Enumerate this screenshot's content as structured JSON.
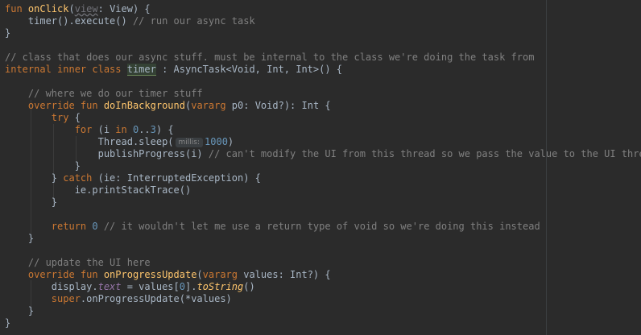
{
  "editor": {
    "lines": {
      "l1": {
        "kw": "fun ",
        "name": "onClick",
        "open": "(",
        "param": "view",
        "rest": ": View) {"
      },
      "l2": {
        "code": "    timer().execute() ",
        "comment": "// run our async task"
      },
      "l3": {
        "code": "}"
      },
      "l5": {
        "comment": "// class that does our async stuff. must be internal to the class we're doing the task from"
      },
      "l6": {
        "kw": "internal inner class ",
        "name": "timer",
        "rest": " : AsyncTask<Void, Int, Int>() {"
      },
      "l8": {
        "comment": "    // where we do our timer stuff"
      },
      "l9": {
        "kw": "    override fun ",
        "name": "doInBackground",
        "open": "(",
        "kw2": "vararg ",
        "rest": "p0: Void?): Int {"
      },
      "l10": {
        "kw": "        try ",
        "rest": "{"
      },
      "l11": {
        "kw": "            for ",
        "a": "(i ",
        "kw2": "in ",
        "n1": "0",
        "b": "..",
        "n2": "3",
        "c": ") {"
      },
      "l12": {
        "code": "                Thread.sleep(",
        "hint": "millis:",
        "num": "1000",
        "rest": ")"
      },
      "l13": {
        "code": "                publishProgress(i) ",
        "comment": "// can't modify the UI from this thread so we pass the value to the UI thread"
      },
      "l14": {
        "code": "            }"
      },
      "l15": {
        "a": "        } ",
        "kw": "catch ",
        "rest": "(ie: InterruptedException) {"
      },
      "l16": {
        "code": "            ie.printStackTrace()"
      },
      "l17": {
        "code": "        }"
      },
      "l19": {
        "kw": "        return ",
        "num": "0",
        "comment": " // it wouldn't let me use a return type of void so we're doing this instead"
      },
      "l20": {
        "code": "    }"
      },
      "l22": {
        "comment": "    // update the UI here"
      },
      "l23": {
        "kw": "    override fun ",
        "name": "onProgressUpdate",
        "open": "(",
        "kw2": "vararg ",
        "rest": "values: Int?) {"
      },
      "l24": {
        "a": "        display.",
        "prop": "text",
        "b": " = values[",
        "num": "0",
        "c": "].",
        "fn": "toString",
        "d": "()"
      },
      "l25": {
        "kw": "        super",
        "rest": ".onProgressUpdate(*values)"
      },
      "l26": {
        "code": "    }"
      },
      "l27": {
        "code": "}"
      }
    }
  },
  "colors": {
    "background": "#2b2b2b",
    "keyword": "#cc7832",
    "function": "#ffc66d",
    "comment": "#808080",
    "number": "#6897bb",
    "plain": "#a9b7c6",
    "property": "#9876aa"
  }
}
